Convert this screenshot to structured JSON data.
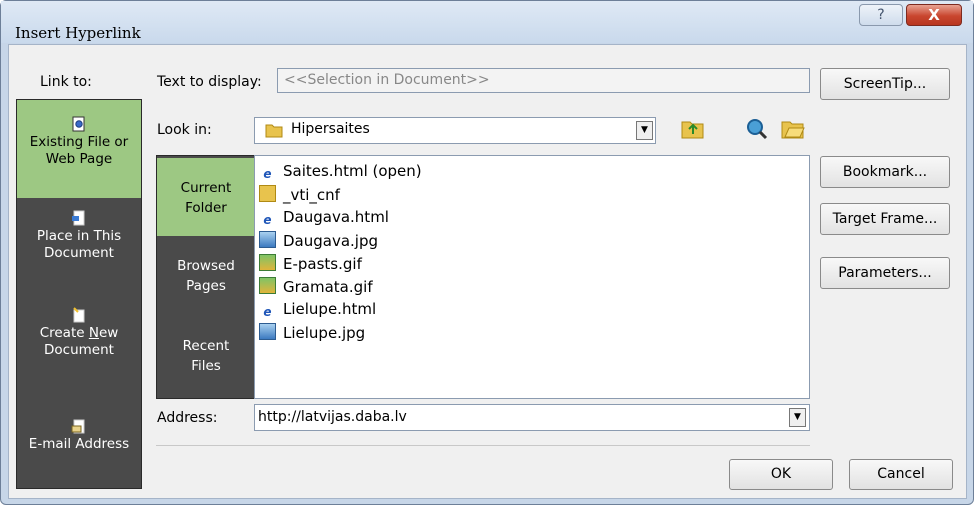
{
  "window": {
    "title": "Insert Hyperlink",
    "help_glyph": "?",
    "close_glyph": "X"
  },
  "link_to": {
    "label": "Link to:",
    "items": [
      {
        "line1": "Existing File or",
        "line2": "Web Page",
        "icon": "existing-file-icon",
        "active": true
      },
      {
        "line1": "Place in This",
        "line2": "Document",
        "icon": "place-in-document-icon",
        "active": false
      },
      {
        "line1": "Create New",
        "line2": "Document",
        "icon": "new-document-icon",
        "active": false
      },
      {
        "line1": "E-mail Address",
        "line2": "",
        "icon": "email-address-icon",
        "active": false
      }
    ]
  },
  "text_to_display": {
    "label": "Text to display:",
    "value": "<<Selection in Document>>"
  },
  "screentip_button": "ScreenTip...",
  "look_in": {
    "label": "Look in:",
    "value": "Hipersaites"
  },
  "folder_nav": [
    {
      "line1": "Current",
      "line2": "Folder",
      "active": true
    },
    {
      "line1": "Browsed",
      "line2": "Pages",
      "active": false
    },
    {
      "line1": "Recent",
      "line2": "Files",
      "active": false
    }
  ],
  "files": [
    {
      "name": "Saites.html (open)",
      "icon": "ie-html-icon"
    },
    {
      "name": "_vti_cnf",
      "icon": "folder-icon"
    },
    {
      "name": "Daugava.html",
      "icon": "ie-html-icon"
    },
    {
      "name": "Daugava.jpg",
      "icon": "jpg-image-icon"
    },
    {
      "name": "E-pasts.gif",
      "icon": "gif-image-icon"
    },
    {
      "name": "Gramata.gif",
      "icon": "gif-image-icon"
    },
    {
      "name": "Lielupe.html",
      "icon": "ie-html-icon"
    },
    {
      "name": "Lielupe.jpg",
      "icon": "jpg-image-icon"
    }
  ],
  "side_buttons": {
    "bookmark": "Bookmark...",
    "target_frame": "Target Frame...",
    "parameters": "Parameters..."
  },
  "address": {
    "label": "Address:",
    "value": "http://latvijas.daba.lv"
  },
  "ok_button": "OK",
  "cancel_button": "Cancel"
}
